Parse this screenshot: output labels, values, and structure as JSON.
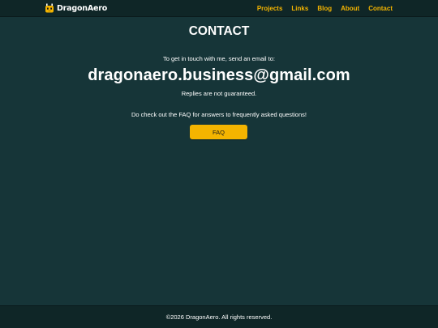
{
  "nav": {
    "brand": "DragonAero",
    "logo_icon": "dragon-mascot-icon",
    "links": [
      "Projects",
      "Links",
      "Blog",
      "About",
      "Contact"
    ]
  },
  "main": {
    "title": "CONTACT",
    "intro": "To get in touch with me, send an email to:",
    "email": "dragonaero.business@gmail.com",
    "note": "Replies are not guaranteed.",
    "faq_text": "Do check out the FAQ for answers to frequently asked questions!",
    "faq_button": "FAQ"
  },
  "footer": {
    "text": "©2026 DragonAero. All rights reserved."
  },
  "colors": {
    "background": "#163538",
    "navbar": "#0f2627",
    "accent": "#f4b400",
    "text": "#ffffff"
  }
}
